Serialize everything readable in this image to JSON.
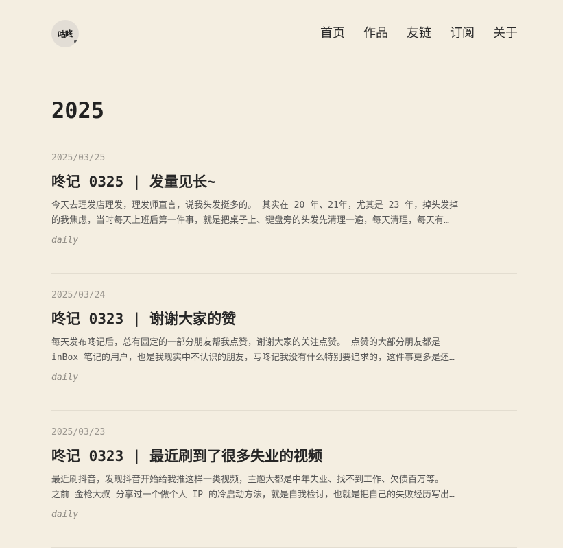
{
  "site": {
    "logo_text": "咕咚"
  },
  "nav": {
    "items": [
      {
        "label": "首页"
      },
      {
        "label": "作品"
      },
      {
        "label": "友链"
      },
      {
        "label": "订阅"
      },
      {
        "label": "关于"
      }
    ]
  },
  "main": {
    "year": "2025",
    "posts": [
      {
        "date": "2025/03/25",
        "title": "咚记 0325 | 发量见长~",
        "excerpt_line1": "今天去理发店理发，理发师直言，说我头发挺多的。 其实在 20 年、21年，尤其是 23 年，掉头发掉",
        "excerpt_line2": "的我焦虑，当时每天上班后第一件事，就是把桌子上、键盘旁的头发先清理一遍，每天清理，每天有…",
        "tag": "daily"
      },
      {
        "date": "2025/03/24",
        "title": "咚记 0323 | 谢谢大家的赞",
        "excerpt_line1": "每天发布咚记后，总有固定的一部分朋友帮我点赞，谢谢大家的关注点赞。 点赞的大部分朋友都是",
        "excerpt_line2": "inBox 笔记的用户，也是我现实中不认识的朋友，写咚记我没有什么特别要追求的，这件事更多是还…",
        "tag": "daily"
      },
      {
        "date": "2025/03/23",
        "title": "咚记 0323 | 最近刷到了很多失业的视频",
        "excerpt_line1": "最近刷抖音，发现抖音开始给我推这样一类视频，主题大都是中年失业、找不到工作、欠债百万等。",
        "excerpt_line2": "之前 金枪大叔 分享过一个做个人 IP 的冷启动方法，就是自我检讨，也就是把自己的失败经历写出…",
        "tag": "daily"
      }
    ]
  }
}
